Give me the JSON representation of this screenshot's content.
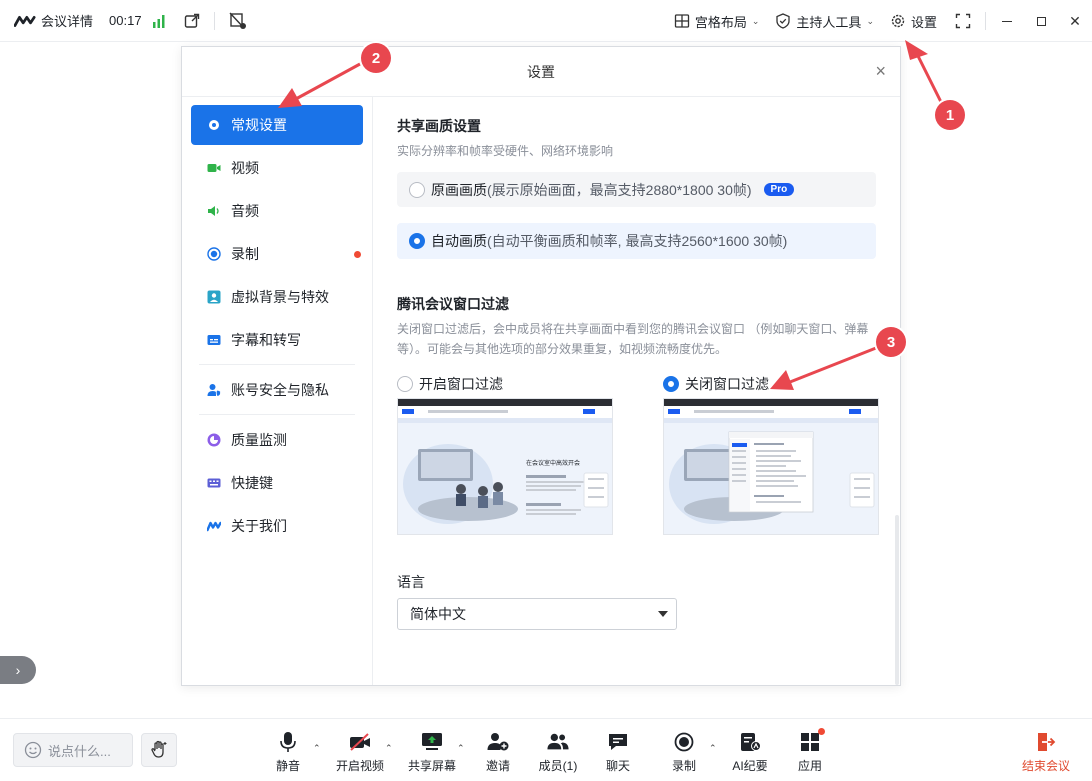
{
  "topbar": {
    "meeting_details": "会议详情",
    "duration": "00:17",
    "layout": "宫格布局",
    "host_tools": "主持人工具",
    "settings": "设置"
  },
  "dialog": {
    "title": "设置",
    "nav": [
      {
        "label": "常规设置",
        "icon": "gear-icon",
        "active": true
      },
      {
        "label": "视频",
        "icon": "video-icon"
      },
      {
        "label": "音频",
        "icon": "speaker-icon"
      },
      {
        "label": "录制",
        "icon": "record-icon"
      },
      {
        "label": "虚拟背景与特效",
        "icon": "portrait-icon"
      },
      {
        "label": "字幕和转写",
        "icon": "caption-icon"
      },
      {
        "label": "账号安全与隐私",
        "icon": "account-shield-icon"
      },
      {
        "label": "质量监测",
        "icon": "monitor-icon"
      },
      {
        "label": "快捷键",
        "icon": "keyboard-icon"
      },
      {
        "label": "关于我们",
        "icon": "logo-icon"
      }
    ],
    "share_quality": {
      "title": "共享画质设置",
      "subtitle": "实际分辨率和帧率受硬件、网络环境影响",
      "options": [
        {
          "name": "原画画质",
          "detail": "(展示原始画面，最高支持2880*1800 30帧)",
          "badge": "Pro",
          "selected": false
        },
        {
          "name": "自动画质",
          "detail": "(自动平衡画质和帧率, 最高支持2560*1600 30帧)",
          "selected": true
        }
      ]
    },
    "window_filter": {
      "title": "腾讯会议窗口过滤",
      "desc_line1": "关闭窗口过滤后，会中成员将在共享画面中看到您的腾讯会议窗口 （例如聊天窗口、弹幕",
      "desc_line2": "等）。可能会与其他选项的部分效果重复，如视频流畅度优先。",
      "options": [
        {
          "label": "开启窗口过滤",
          "selected": false
        },
        {
          "label": "关闭窗口过滤",
          "selected": true
        }
      ],
      "preview_heading": "在会议室中高效开会"
    },
    "language": {
      "title": "语言",
      "value": "简体中文"
    }
  },
  "annotations": [
    "1",
    "2",
    "3"
  ],
  "bottombar": {
    "chat_placeholder": "说点什么...",
    "controls": [
      {
        "label": "静音",
        "icon": "mic-icon"
      },
      {
        "label": "开启视频",
        "icon": "video-off-icon"
      },
      {
        "label": "共享屏幕",
        "icon": "share-screen-icon"
      },
      {
        "label": "邀请",
        "icon": "invite-icon"
      },
      {
        "label": "成员(1)",
        "icon": "members-icon"
      },
      {
        "label": "聊天",
        "icon": "chat-icon"
      },
      {
        "label": "录制",
        "icon": "record-icon"
      },
      {
        "label": "AI纪要",
        "icon": "ai-notes-icon"
      },
      {
        "label": "应用",
        "icon": "apps-icon"
      }
    ],
    "end_meeting": "结束会议"
  },
  "colors": {
    "accent": "#1a73e8",
    "annotation_red": "#e8474f",
    "end_red": "#e04a2f",
    "signal_green": "#2fb34a"
  }
}
